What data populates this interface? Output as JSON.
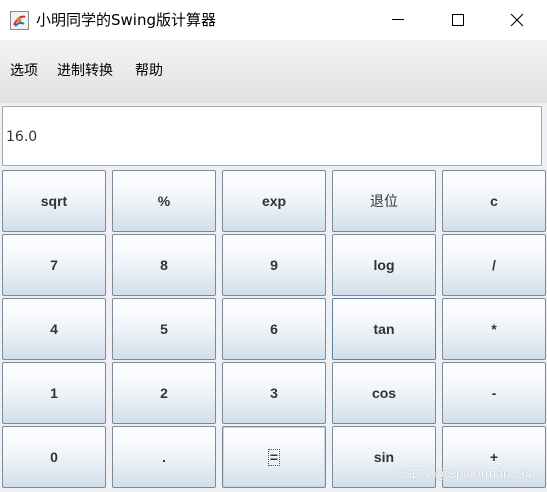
{
  "window": {
    "title": "小明同学的Swing版计算器"
  },
  "menu": {
    "items": [
      "选项",
      "进制转换",
      "帮助"
    ]
  },
  "display": {
    "value": "16.0"
  },
  "keypad": {
    "rows": [
      [
        "sqrt",
        "%",
        "exp",
        "退位",
        "c"
      ],
      [
        "7",
        "8",
        "9",
        "log",
        "/"
      ],
      [
        "4",
        "5",
        "6",
        "tan",
        "*"
      ],
      [
        "1",
        "2",
        "3",
        "cos",
        "-"
      ],
      [
        "0",
        ".",
        "=",
        "sin",
        "+"
      ]
    ]
  },
  "watermark": "CSDN @Spiderman_94",
  "colors": {
    "button_top": "#ffffff",
    "button_bottom": "#d1dfea",
    "button_border": "#7a8a99"
  }
}
